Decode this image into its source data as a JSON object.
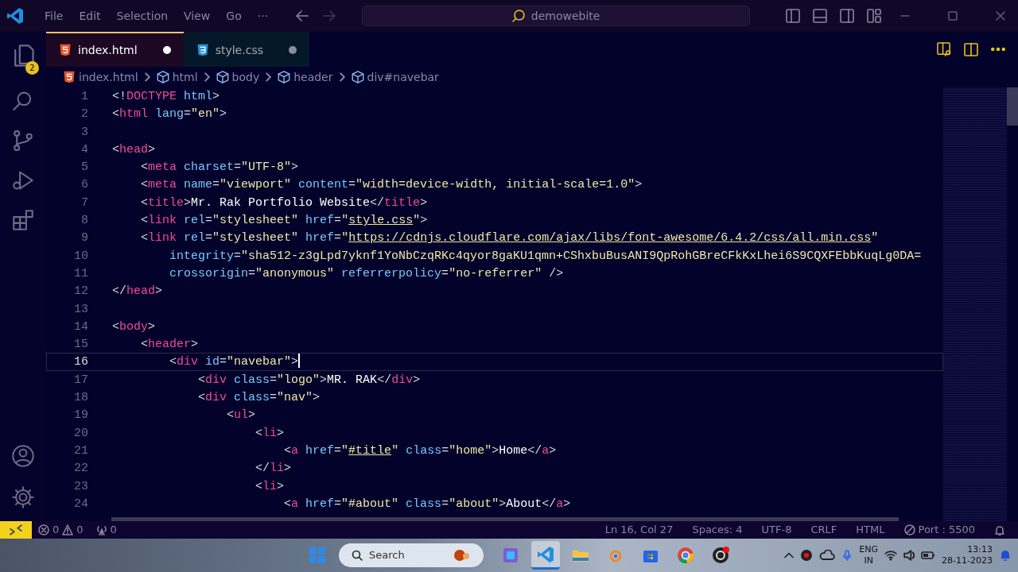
{
  "title_bar": {
    "menu": [
      "File",
      "Edit",
      "Selection",
      "View",
      "Go",
      "···"
    ],
    "command_center": "demowebite"
  },
  "activity_bar": {
    "explorer_badge": "2"
  },
  "tabs": [
    {
      "label": "index.html",
      "kind": "html",
      "selected": true,
      "modified": true
    },
    {
      "label": "style.css",
      "kind": "css",
      "selected": false,
      "modified": true
    }
  ],
  "breadcrumbs": [
    {
      "label": "index.html",
      "kind": "file"
    },
    {
      "label": "html",
      "kind": "element"
    },
    {
      "label": "body",
      "kind": "element"
    },
    {
      "label": "header",
      "kind": "element"
    },
    {
      "label": "div#navebar",
      "kind": "element"
    }
  ],
  "editor": {
    "lines": [
      {
        "n": "1",
        "current": false,
        "tokens": [
          {
            "kind": "punct",
            "t": "<!"
          },
          {
            "kind": "tag",
            "t": "DOCTYPE"
          },
          {
            "kind": "attr",
            "t": " html"
          },
          {
            "kind": "punct",
            "t": ">"
          }
        ]
      },
      {
        "n": "2",
        "current": false,
        "tokens": [
          {
            "kind": "punct",
            "t": "<"
          },
          {
            "kind": "tag",
            "t": "html"
          },
          {
            "kind": "attr",
            "t": " lang"
          },
          {
            "kind": "punct",
            "t": "="
          },
          {
            "kind": "string",
            "t": "\"en\""
          },
          {
            "kind": "punct",
            "t": ">"
          }
        ]
      },
      {
        "n": "3",
        "current": false
      },
      {
        "n": "4",
        "current": false,
        "tokens": [
          {
            "kind": "punct",
            "t": "<"
          },
          {
            "kind": "tag",
            "t": "head"
          },
          {
            "kind": "punct",
            "t": ">"
          }
        ]
      },
      {
        "n": "5",
        "current": false,
        "tokens": [
          {
            "kind": "punct",
            "t": "    <"
          },
          {
            "kind": "tag",
            "t": "meta"
          },
          {
            "kind": "attr",
            "t": " charset"
          },
          {
            "kind": "punct",
            "t": "="
          },
          {
            "kind": "string",
            "t": "\"UTF-8\""
          },
          {
            "kind": "punct",
            "t": ">"
          }
        ]
      },
      {
        "n": "6",
        "current": false,
        "tokens": [
          {
            "kind": "punct",
            "t": "    <"
          },
          {
            "kind": "tag",
            "t": "meta"
          },
          {
            "kind": "attr",
            "t": " name"
          },
          {
            "kind": "punct",
            "t": "="
          },
          {
            "kind": "string",
            "t": "\"viewport\""
          },
          {
            "kind": "attr",
            "t": " content"
          },
          {
            "kind": "punct",
            "t": "="
          },
          {
            "kind": "string",
            "t": "\"width=device-width, initial-scale=1.0\""
          },
          {
            "kind": "punct",
            "t": ">"
          }
        ]
      },
      {
        "n": "7",
        "current": false,
        "tokens": [
          {
            "kind": "punct",
            "t": "    <"
          },
          {
            "kind": "tag",
            "t": "title"
          },
          {
            "kind": "punct",
            "t": ">"
          },
          {
            "kind": "text",
            "t": "Mr. Rak Portfolio Website"
          },
          {
            "kind": "punct",
            "t": "</"
          },
          {
            "kind": "tag",
            "t": "title"
          },
          {
            "kind": "punct",
            "t": ">"
          }
        ]
      },
      {
        "n": "8",
        "current": false,
        "tokens": [
          {
            "kind": "punct",
            "t": "    <"
          },
          {
            "kind": "tag",
            "t": "link"
          },
          {
            "kind": "attr",
            "t": " rel"
          },
          {
            "kind": "punct",
            "t": "="
          },
          {
            "kind": "string",
            "t": "\"stylesheet\""
          },
          {
            "kind": "attr",
            "t": " href"
          },
          {
            "kind": "punct",
            "t": "="
          },
          {
            "kind": "string",
            "t": "\""
          },
          {
            "kind": "url",
            "t": "style.css"
          },
          {
            "kind": "string",
            "t": "\""
          },
          {
            "kind": "punct",
            "t": ">"
          }
        ]
      },
      {
        "n": "9",
        "current": false,
        "tokens": [
          {
            "kind": "punct",
            "t": "    <"
          },
          {
            "kind": "tag",
            "t": "link"
          },
          {
            "kind": "attr",
            "t": " rel"
          },
          {
            "kind": "punct",
            "t": "="
          },
          {
            "kind": "string",
            "t": "\"stylesheet\""
          },
          {
            "kind": "attr",
            "t": " href"
          },
          {
            "kind": "punct",
            "t": "="
          },
          {
            "kind": "string",
            "t": "\""
          },
          {
            "kind": "url",
            "t": "https://cdnjs.cloudflare.com/ajax/libs/font-awesome/6.4.2/css/all.min.css"
          },
          {
            "kind": "string",
            "t": "\""
          }
        ]
      },
      {
        "n": "10",
        "current": false,
        "tokens": [
          {
            "kind": "attr",
            "t": "        integrity"
          },
          {
            "kind": "punct",
            "t": "="
          },
          {
            "kind": "string",
            "t": "\"sha512-z3gLpd7yknf1YoNbCzqRKc4qyor8gaKU1qmn+CShxbuBusANI9QpRohGBreCFkKxLhei6S9CQXFEbbKuqLg0DA="
          }
        ]
      },
      {
        "n": "11",
        "current": false,
        "tokens": [
          {
            "kind": "attr",
            "t": "        crossorigin"
          },
          {
            "kind": "punct",
            "t": "="
          },
          {
            "kind": "string",
            "t": "\"anonymous\""
          },
          {
            "kind": "attr",
            "t": " referrerpolicy"
          },
          {
            "kind": "punct",
            "t": "="
          },
          {
            "kind": "string",
            "t": "\"no-referrer\""
          },
          {
            "kind": "punct",
            "t": " />"
          }
        ]
      },
      {
        "n": "12",
        "current": false,
        "tokens": [
          {
            "kind": "punct",
            "t": "</"
          },
          {
            "kind": "tag",
            "t": "head"
          },
          {
            "kind": "punct",
            "t": ">"
          }
        ]
      },
      {
        "n": "13",
        "current": false
      },
      {
        "n": "14",
        "current": false,
        "tokens": [
          {
            "kind": "punct",
            "t": "<"
          },
          {
            "kind": "tag",
            "t": "body"
          },
          {
            "kind": "punct",
            "t": ">"
          }
        ]
      },
      {
        "n": "15",
        "current": false,
        "tokens": [
          {
            "kind": "punct",
            "t": "    <"
          },
          {
            "kind": "tag",
            "t": "header"
          },
          {
            "kind": "punct",
            "t": ">"
          }
        ]
      },
      {
        "n": "16",
        "current": true,
        "tokens": [
          {
            "kind": "punct",
            "t": "        <"
          },
          {
            "kind": "tag",
            "t": "div"
          },
          {
            "kind": "attr",
            "t": " id"
          },
          {
            "kind": "punct",
            "t": "="
          },
          {
            "kind": "string",
            "t": "\"navebar\""
          },
          {
            "kind": "punct",
            "t": ">"
          }
        ]
      },
      {
        "n": "17",
        "current": false,
        "tokens": [
          {
            "kind": "punct",
            "t": "            <"
          },
          {
            "kind": "tag",
            "t": "div"
          },
          {
            "kind": "attr",
            "t": " class"
          },
          {
            "kind": "punct",
            "t": "="
          },
          {
            "kind": "string",
            "t": "\"logo\""
          },
          {
            "kind": "punct",
            "t": ">"
          },
          {
            "kind": "text",
            "t": "MR. RAK"
          },
          {
            "kind": "punct",
            "t": "</"
          },
          {
            "kind": "tag",
            "t": "div"
          },
          {
            "kind": "punct",
            "t": ">"
          }
        ]
      },
      {
        "n": "18",
        "current": false,
        "tokens": [
          {
            "kind": "punct",
            "t": "            <"
          },
          {
            "kind": "tag",
            "t": "div"
          },
          {
            "kind": "attr",
            "t": " class"
          },
          {
            "kind": "punct",
            "t": "="
          },
          {
            "kind": "string",
            "t": "\"nav\""
          },
          {
            "kind": "punct",
            "t": ">"
          }
        ]
      },
      {
        "n": "19",
        "current": false,
        "tokens": [
          {
            "kind": "punct",
            "t": "                <"
          },
          {
            "kind": "tag",
            "t": "ul"
          },
          {
            "kind": "punct",
            "t": ">"
          }
        ]
      },
      {
        "n": "20",
        "current": false,
        "tokens": [
          {
            "kind": "punct",
            "t": "                    <"
          },
          {
            "kind": "tag",
            "t": "li"
          },
          {
            "kind": "punct",
            "t": ">"
          }
        ]
      },
      {
        "n": "21",
        "current": false,
        "tokens": [
          {
            "kind": "punct",
            "t": "                        <"
          },
          {
            "kind": "tag",
            "t": "a"
          },
          {
            "kind": "attr",
            "t": " href"
          },
          {
            "kind": "punct",
            "t": "="
          },
          {
            "kind": "string",
            "t": "\""
          },
          {
            "kind": "url",
            "t": "#title"
          },
          {
            "kind": "string",
            "t": "\""
          },
          {
            "kind": "attr",
            "t": " class"
          },
          {
            "kind": "punct",
            "t": "="
          },
          {
            "kind": "string",
            "t": "\"home\""
          },
          {
            "kind": "punct",
            "t": ">"
          },
          {
            "kind": "text",
            "t": "Home"
          },
          {
            "kind": "punct",
            "t": "</"
          },
          {
            "kind": "tag",
            "t": "a"
          },
          {
            "kind": "punct",
            "t": ">"
          }
        ]
      },
      {
        "n": "22",
        "current": false,
        "tokens": [
          {
            "kind": "punct",
            "t": "                    </"
          },
          {
            "kind": "tag",
            "t": "li"
          },
          {
            "kind": "punct",
            "t": ">"
          }
        ]
      },
      {
        "n": "23",
        "current": false,
        "tokens": [
          {
            "kind": "punct",
            "t": "                    <"
          },
          {
            "kind": "tag",
            "t": "li"
          },
          {
            "kind": "punct",
            "t": ">"
          }
        ]
      },
      {
        "n": "24",
        "current": false,
        "tokens": [
          {
            "kind": "punct",
            "t": "                        <"
          },
          {
            "kind": "tag",
            "t": "a"
          },
          {
            "kind": "attr",
            "t": " href"
          },
          {
            "kind": "punct",
            "t": "="
          },
          {
            "kind": "string",
            "t": "\"#about\""
          },
          {
            "kind": "attr",
            "t": " class"
          },
          {
            "kind": "punct",
            "t": "="
          },
          {
            "kind": "string",
            "t": "\"about\""
          },
          {
            "kind": "punct",
            "t": ">"
          },
          {
            "kind": "text",
            "t": "About"
          },
          {
            "kind": "punct",
            "t": "</"
          },
          {
            "kind": "tag",
            "t": "a"
          },
          {
            "kind": "punct",
            "t": ">"
          }
        ]
      }
    ]
  },
  "status_bar": {
    "errors": "0",
    "warnings": "0",
    "ports": "0",
    "right": [
      "Ln 16, Col 27",
      "Spaces: 4",
      "UTF-8",
      "CRLF",
      "HTML"
    ],
    "port": "Port : 5500"
  },
  "taskbar": {
    "search": "Search",
    "apps": [
      {
        "kind": "app-tile",
        "selected": false
      },
      {
        "kind": "vscode",
        "selected": true
      },
      {
        "kind": "folder",
        "selected": false
      },
      {
        "kind": "ring",
        "selected": false
      },
      {
        "kind": "store",
        "selected": false
      },
      {
        "kind": "chrome",
        "selected": false
      },
      {
        "kind": "record",
        "selected": false
      }
    ],
    "language": [
      "ENG",
      "IN"
    ],
    "time": "13:13",
    "date": "28-11-2023"
  }
}
